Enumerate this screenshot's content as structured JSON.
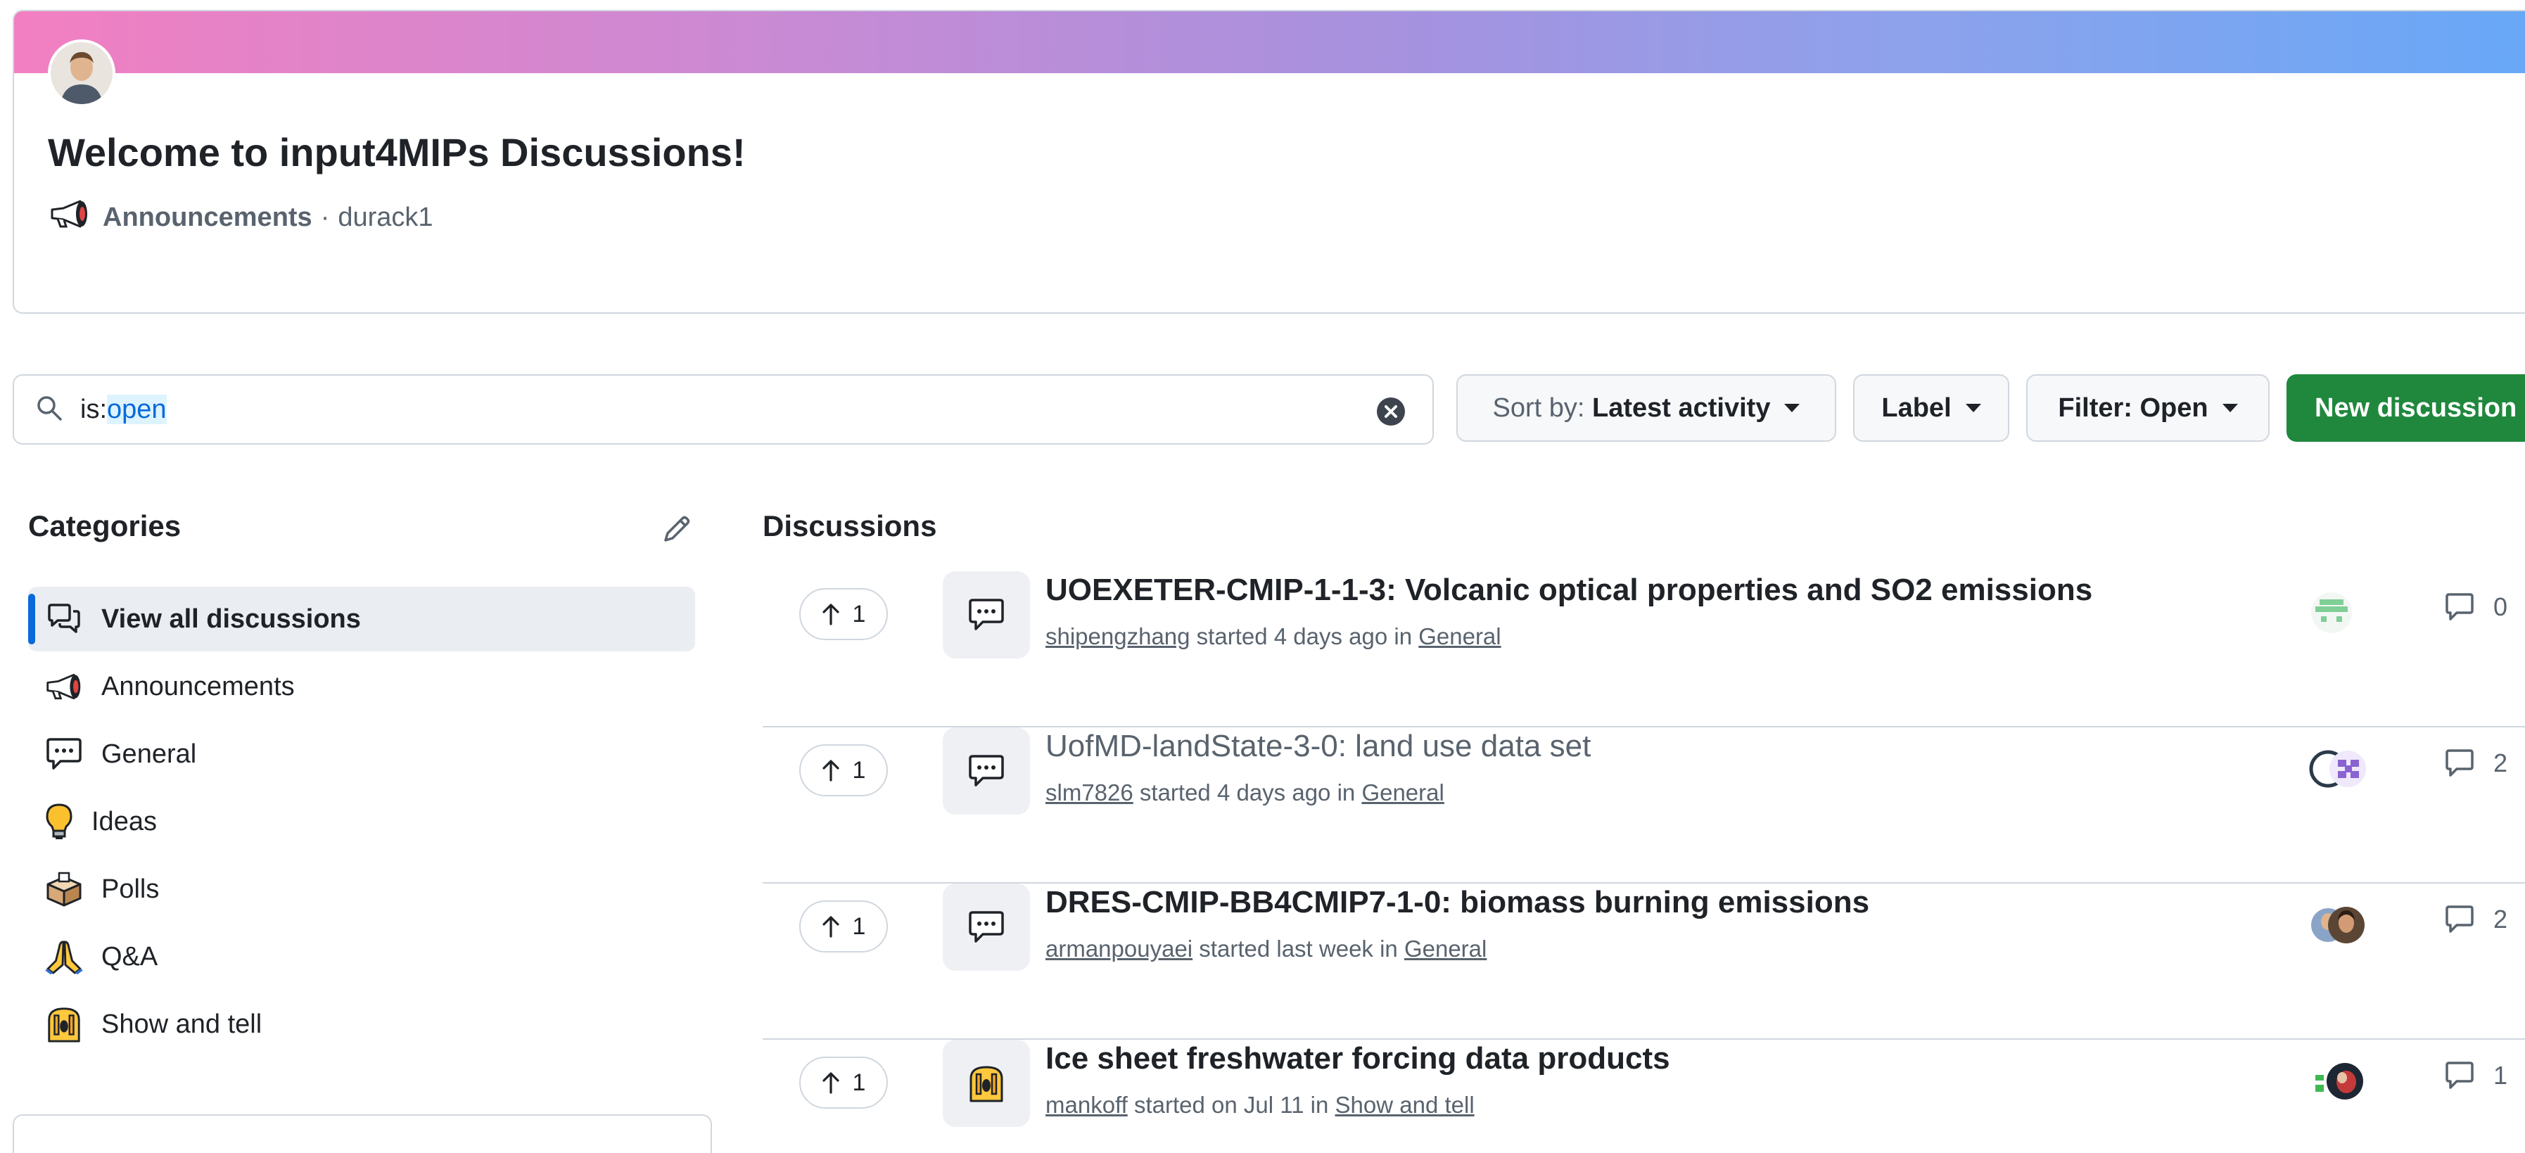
{
  "welcome": {
    "title": "Welcome to input4MIPs Discussions!",
    "category": "Announcements",
    "separator": "·",
    "author": "durack1"
  },
  "search": {
    "prefix": "is:",
    "value": "open"
  },
  "toolbar": {
    "sort_label": "Sort by:",
    "sort_value": "Latest activity",
    "label_button": "Label",
    "filter_button": "Filter: Open",
    "new_button": "New discussion"
  },
  "categories": {
    "heading": "Categories",
    "items": [
      {
        "label": "View all discussions",
        "icon": "discussions-icon"
      },
      {
        "label": "Announcements",
        "icon": "megaphone-icon"
      },
      {
        "label": "General",
        "icon": "speech-bubble-icon"
      },
      {
        "label": "Ideas",
        "icon": "lightbulb-icon"
      },
      {
        "label": "Polls",
        "icon": "ballot-box-icon"
      },
      {
        "label": "Q&A",
        "icon": "praying-hands-icon"
      },
      {
        "label": "Show and tell",
        "icon": "raising-hands-icon"
      }
    ]
  },
  "discussions": {
    "heading": "Discussions",
    "items": [
      {
        "votes": "1",
        "title": "UOEXETER-CMIP-1-1-3: Volcanic optical properties and SO2 emissions",
        "author": "shipengzhang",
        "started": " started 4 days ago in ",
        "category": "General",
        "comments": "0",
        "icon": "speech-bubble-icon"
      },
      {
        "votes": "1",
        "title": "UofMD-landState-3-0: land use data set",
        "author": "slm7826",
        "started": " started 4 days ago in ",
        "category": "General",
        "comments": "2",
        "icon": "speech-bubble-icon"
      },
      {
        "votes": "1",
        "title": "DRES-CMIP-BB4CMIP7-1-0: biomass burning emissions",
        "author": "armanpouyaei",
        "started": " started last week in ",
        "category": "General",
        "comments": "2",
        "icon": "speech-bubble-icon"
      },
      {
        "votes": "1",
        "title": "Ice sheet freshwater forcing data products",
        "author": "mankoff",
        "started": " started on Jul 11 in ",
        "category": "Show and tell",
        "comments": "1",
        "icon": "raising-hands-icon"
      }
    ]
  },
  "colors": {
    "accent": "#0969da",
    "primary_button": "#1f883d",
    "border": "#d0d7de",
    "muted_text": "#59636e"
  }
}
